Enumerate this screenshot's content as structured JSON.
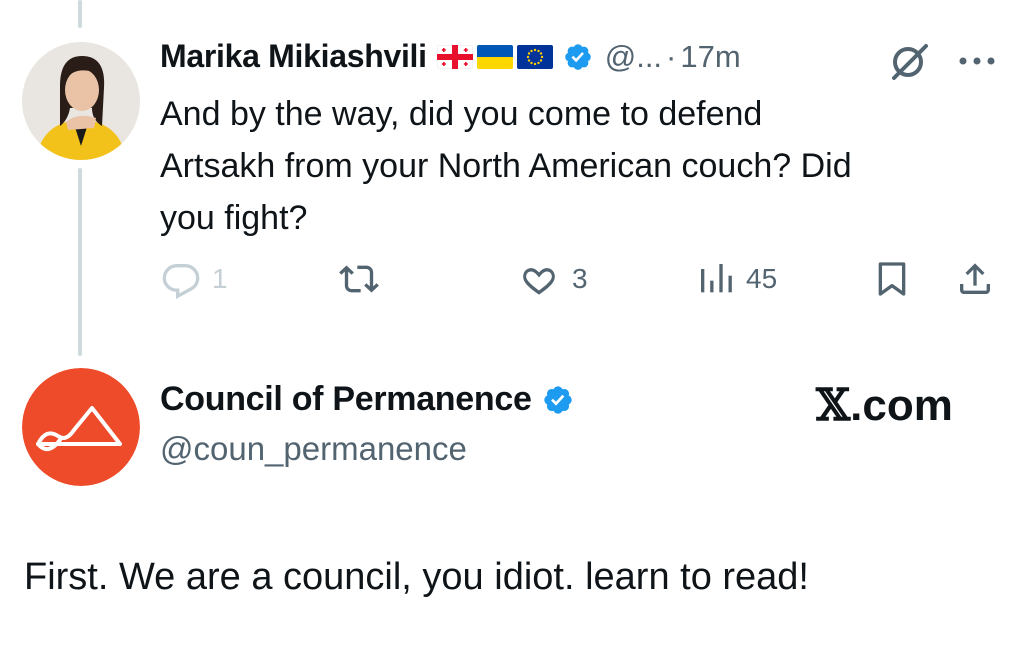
{
  "reply": {
    "author": {
      "display_name": "Marika Mikiashvili",
      "flags": [
        "georgia-flag-icon",
        "ukraine-flag-icon",
        "eu-flag-icon"
      ],
      "handle": "@...",
      "separator": "·",
      "timestamp": "17m"
    },
    "text": "And by the way, did you come to defend\nArtsakh from your North American couch? Did\nyou fight?",
    "actions": {
      "replies": "1",
      "likes": "3",
      "views": "45"
    }
  },
  "parent": {
    "display_name": "Council of Permanence",
    "handle": "@coun_permanence",
    "brand_x": "𝕏",
    "brand_suffix": ".com",
    "avatar_color": "#ee4b2b"
  },
  "overlay_caption": "First. We are a council, you idiot. learn to read!",
  "colors": {
    "verified_blue": "#1d9bf0",
    "secondary_text": "#536471",
    "thread_line": "#cfd9de"
  }
}
